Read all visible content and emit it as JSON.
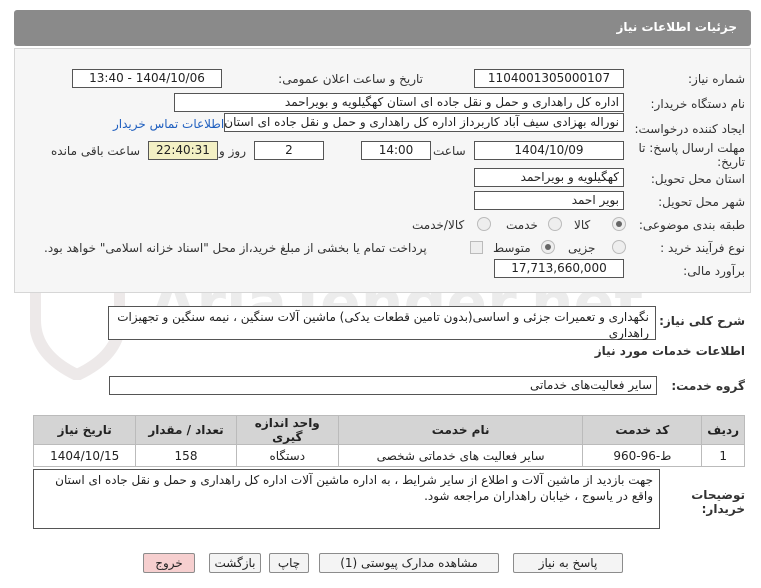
{
  "header": {
    "title": "جزئیات اطلاعات نیاز"
  },
  "form": {
    "need_number_label": "شماره نیاز:",
    "need_number": "1104001305000107",
    "announce_label": "تاریخ و ساعت اعلان عمومی:",
    "announce_value": "1404/10/06 - 13:40",
    "buyer_org_label": "نام دستگاه خریدار:",
    "buyer_org": "اداره کل راهداری و حمل و نقل جاده ای استان کهگیلویه و بویراحمد",
    "creator_label": "ایجاد کننده درخواست:",
    "creator": "نوراله بهزادی سیف آباد کاربرداز اداره کل راهداری و حمل و نقل جاده ای استان ک",
    "contact_link": "اطلاعات تماس خریدار",
    "deadline_label_1": "مهلت ارسال پاسخ: تا",
    "deadline_label_2": "تاریخ:",
    "deadline_date": "1404/10/09",
    "time_label": "ساعت",
    "deadline_time": "14:00",
    "days_value": "2",
    "days_label": "روز و",
    "remaining_time": "22:40:31",
    "remaining_label": "ساعت باقی مانده",
    "province_label": "استان محل تحویل:",
    "province": "کهگیلویه و بویراحمد",
    "city_label": "شهر محل تحویل:",
    "city": "بویر احمد",
    "category_label": "طبقه بندی موضوعی:",
    "category_options": [
      "کالا",
      "خدمت",
      "کالا/خدمت"
    ],
    "purchase_type_label": "نوع فرآیند خرید :",
    "purchase_options": [
      "جزیی",
      "متوسط"
    ],
    "payment_note": "پرداخت تمام یا بخشی از مبلغ خرید،از محل \"اسناد خزانه اسلامی\" خواهد بود.",
    "estimate_label": "برآورد مالی:",
    "estimate_value": "17,713,660,000"
  },
  "description": {
    "label": "شرح کلی نیاز:",
    "text": "نگهداری و تعمیرات جزئی و اساسی(بدون تامین قطعات یدکی) ماشین آلات سنگین ، نیمه سنگین و تجهیزات راهداری"
  },
  "services": {
    "section_title": "اطلاعات خدمات مورد نیاز",
    "group_label": "گروه خدمت:",
    "group_value": "سایر فعالیت‌های خدماتی",
    "columns": [
      "ردیف",
      "کد خدمت",
      "نام خدمت",
      "واحد اندازه گیری",
      "تعداد / مقدار",
      "تاریخ نیاز"
    ],
    "rows": [
      [
        "1",
        "ط-96-960",
        "سایر فعالیت های خدماتی شخصی",
        "دستگاه",
        "158",
        "1404/10/15"
      ]
    ]
  },
  "buyer_notes": {
    "label": "توضیحات خریدار:",
    "text": "جهت بازدید از ماشین آلات و اطلاع از سایر شرایط ، به اداره ماشین آلات اداره کل راهداری و حمل و نقل جاده ای استان واقع در یاسوج ، خیابان راهداران مراجعه شود."
  },
  "buttons": {
    "respond": "پاسخ به نیاز",
    "view_docs": "مشاهده مدارک پیوستی (1)",
    "print": "چاپ",
    "back": "بازگشت",
    "exit": "خروج"
  },
  "watermark": {
    "text": "AriaTender.net"
  }
}
